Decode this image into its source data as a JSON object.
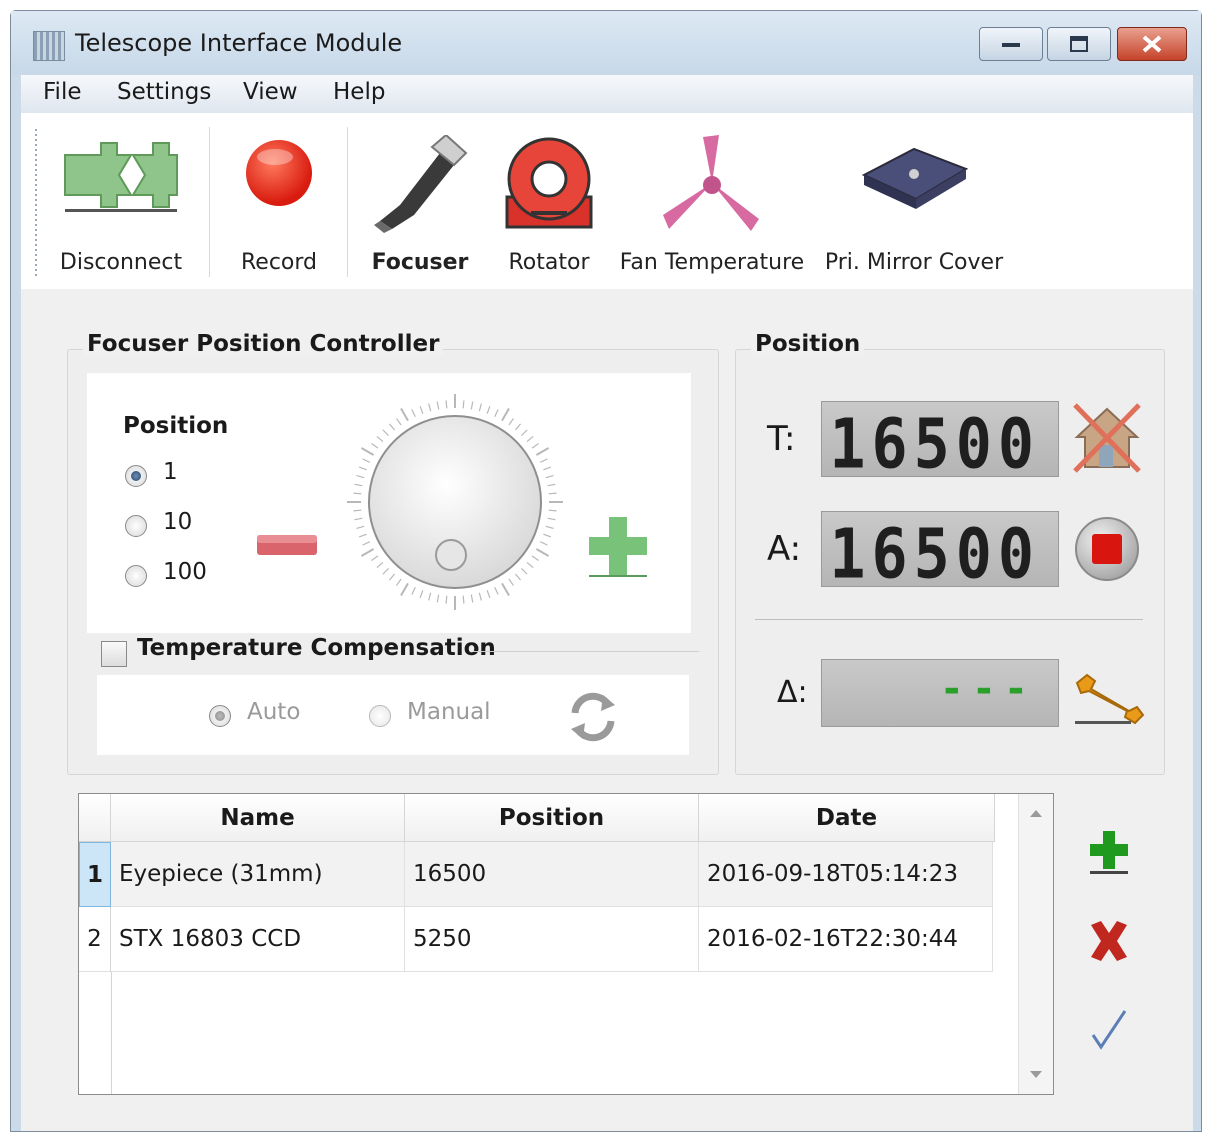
{
  "window": {
    "title": "Telescope Interface Module"
  },
  "menu": [
    "File",
    "Settings",
    "View",
    "Help"
  ],
  "toolbar": {
    "disconnect": "Disconnect",
    "record": "Record",
    "focuser": "Focuser",
    "rotator": "Rotator",
    "fan": "Fan",
    "temperature": "Temperature",
    "mirror_cover": "Pri. Mirror Cover"
  },
  "focuser_controller": {
    "title": "Focuser Position Controller",
    "position_label": "Position",
    "step_options": [
      "1",
      "10",
      "100"
    ],
    "selected_step": "1",
    "temp_comp_label": "Temperature Compensation",
    "temp_comp_checked": false,
    "mode_auto": "Auto",
    "mode_manual": "Manual"
  },
  "position_panel": {
    "title": "Position",
    "target_label": "T:",
    "target_value": "16500",
    "actual_label": "A:",
    "actual_value": "16500",
    "delta_label": "Δ:",
    "delta_value": "---"
  },
  "presets_table": {
    "columns": [
      "Name",
      "Position",
      "Date"
    ],
    "rows": [
      {
        "num": "1",
        "name": "Eyepiece (31mm)",
        "position": "16500",
        "date": "2016-09-18T05:14:23"
      },
      {
        "num": "2",
        "name": "STX 16803 CCD",
        "position": "5250",
        "date": "2016-02-16T22:30:44"
      }
    ]
  },
  "colors": {
    "accent_green": "#1f9a1f",
    "accent_red": "#c0281f",
    "selection_blue": "#cde6f7"
  }
}
